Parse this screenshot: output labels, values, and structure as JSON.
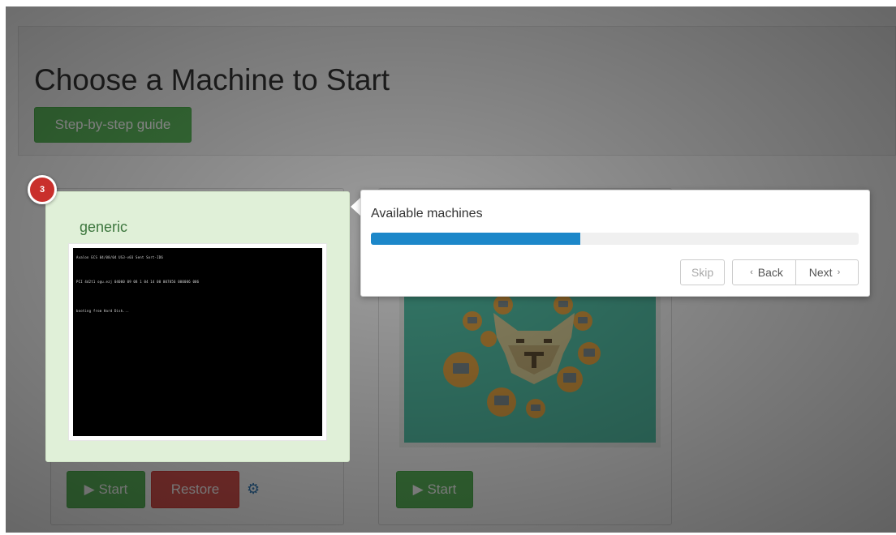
{
  "page": {
    "title": "Choose a Machine to Start",
    "guide_button": "Step-by-step guide"
  },
  "machines": [
    {
      "name": "generic",
      "screen_lines": [
        "Avalon ECS 04/08/04 US3-v03 Sent Sort-ID6",
        "PCI 4d2t1 ogu.ezj 04000 09 08 1 04 14 00 007856 000006 006",
        "booting from Hard Disk..."
      ],
      "start_label": "▶ Start",
      "restore_label": "Restore",
      "settings_icon": "gear-icon"
    },
    {
      "start_label": "▶ Start",
      "image_icon": "camel-network-icon"
    }
  ],
  "tour": {
    "step_number": "3",
    "text": "Available machines",
    "progress_percent": 43,
    "skip_label": "Skip",
    "back_label": "Back",
    "next_label": "Next",
    "back_arrow": "‹",
    "next_arrow": "›"
  },
  "colors": {
    "success": "#5cb85c",
    "danger": "#d9534f",
    "progress": "#1c87c9",
    "highlight_bg": "#e0f0d8",
    "badge": "#c9302c"
  }
}
